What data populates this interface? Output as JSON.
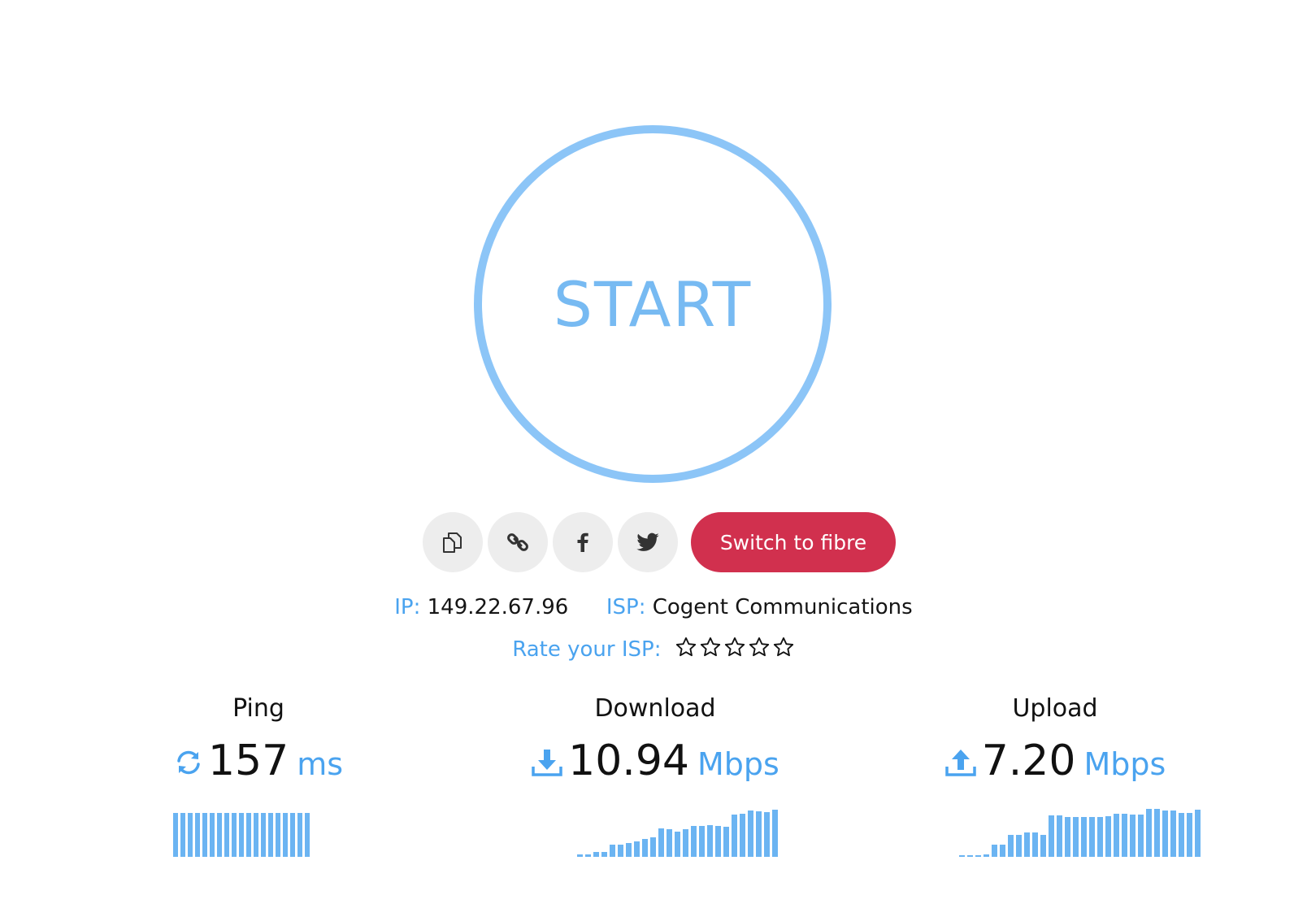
{
  "start_button": {
    "label": "START"
  },
  "share": {
    "copy_icon": "copy-icon",
    "link_icon": "link-icon",
    "facebook_icon": "facebook-icon",
    "twitter_icon": "twitter-icon",
    "switch_label": "Switch to fibre"
  },
  "connection": {
    "ip_label": "IP:",
    "ip_value": "149.22.67.96",
    "isp_label": "ISP:",
    "isp_value": "Cogent Communications"
  },
  "rating": {
    "label": "Rate your ISP:",
    "max_stars": 5,
    "selected": 0
  },
  "metrics": {
    "ping": {
      "title": "Ping",
      "value": "157",
      "unit": "ms",
      "icon": "refresh-icon",
      "history": [
        1,
        1,
        1,
        1,
        1,
        1,
        1,
        1,
        1,
        1,
        1,
        1,
        1,
        1,
        1,
        1,
        1,
        1,
        1
      ]
    },
    "download": {
      "title": "Download",
      "value": "10.94",
      "unit": "Mbps",
      "icon": "download-icon",
      "history": [
        0.05,
        0.05,
        0.1,
        0.1,
        0.25,
        0.25,
        0.28,
        0.32,
        0.36,
        0.4,
        0.58,
        0.56,
        0.52,
        0.56,
        0.63,
        0.63,
        0.65,
        0.63,
        0.62,
        0.87,
        0.88,
        0.95,
        0.93,
        0.92,
        0.97
      ]
    },
    "upload": {
      "title": "Upload",
      "value": "7.20",
      "unit": "Mbps",
      "icon": "upload-icon",
      "history": [
        0.03,
        0.03,
        0.03,
        0.05,
        0.25,
        0.25,
        0.45,
        0.45,
        0.5,
        0.5,
        0.45,
        0.85,
        0.85,
        0.82,
        0.82,
        0.82,
        0.82,
        0.82,
        0.84,
        0.88,
        0.88,
        0.86,
        0.86,
        0.98,
        0.98,
        0.95,
        0.95,
        0.9,
        0.9,
        0.96
      ]
    }
  },
  "colors": {
    "accent": "#4aa3ef",
    "circle": "#8cc5f7",
    "bars": "#6bb4f2",
    "fibre_button": "#d1304e",
    "icon_button_bg": "#ededed"
  }
}
